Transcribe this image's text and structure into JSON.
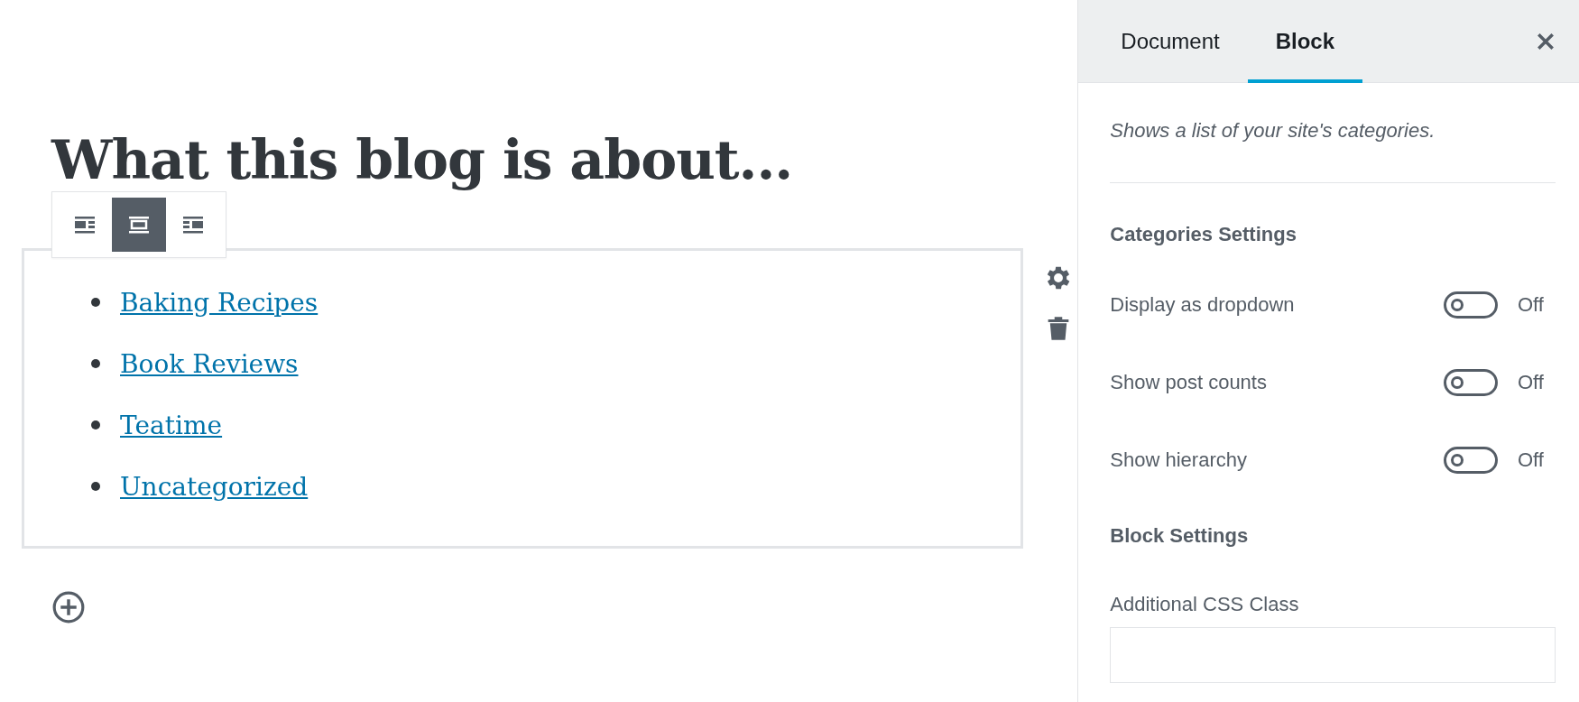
{
  "editor": {
    "title": "What this blog is about...",
    "alignment_toolbar": [
      {
        "kind": "left",
        "selected": false
      },
      {
        "kind": "center",
        "selected": true
      },
      {
        "kind": "right",
        "selected": false
      }
    ],
    "categories": [
      "Baking Recipes",
      "Book Reviews",
      "Teatime",
      "Uncategorized"
    ]
  },
  "sidebar": {
    "tabs": [
      {
        "label": "Document",
        "selected": false
      },
      {
        "label": "Block",
        "selected": true
      }
    ],
    "description": "Shows a list of your site's categories.",
    "sections": [
      {
        "title": "Categories Settings",
        "controls": [
          {
            "kind": "toggle",
            "label": "Display as dropdown",
            "on": false,
            "state_label": "Off"
          },
          {
            "kind": "toggle",
            "label": "Show post counts",
            "on": false,
            "state_label": "Off"
          },
          {
            "kind": "toggle",
            "label": "Show hierarchy",
            "on": false,
            "state_label": "Off"
          }
        ]
      },
      {
        "title": "Block Settings",
        "controls": [
          {
            "kind": "text",
            "label": "Additional CSS Class"
          }
        ]
      }
    ]
  }
}
